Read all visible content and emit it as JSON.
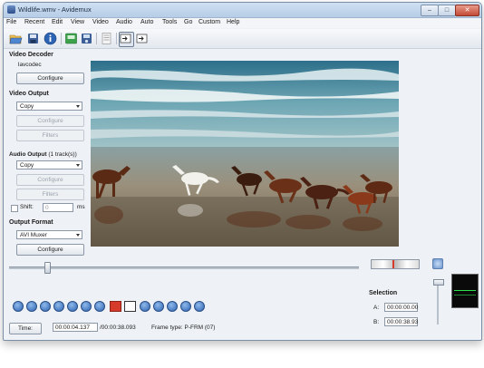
{
  "window": {
    "title": "Wildlife.wmv - Avidemux",
    "minimize": "–",
    "maximize": "□",
    "close": "✕"
  },
  "menu": [
    {
      "label": "File"
    },
    {
      "label": "Recent"
    },
    {
      "label": "Edit"
    },
    {
      "label": "View"
    },
    {
      "label": "Video"
    },
    {
      "label": "Audio"
    },
    {
      "label": "Auto"
    },
    {
      "label": "Tools"
    },
    {
      "label": "Go"
    },
    {
      "label": "Custom"
    },
    {
      "label": "Help"
    }
  ],
  "toolbar": {
    "icons": [
      "open-file-icon",
      "save-file-icon",
      "info-icon",
      "open-folder-icon",
      "save-project-icon",
      "script-icon",
      "input-preview-icon",
      "output-preview-icon"
    ]
  },
  "video_decoder": {
    "heading": "Video Decoder",
    "codec": "lavcodec",
    "configure": "Configure"
  },
  "video_output": {
    "heading": "Video Output",
    "selected": "Copy",
    "configure": "Configure",
    "filters": "Filters"
  },
  "audio_output": {
    "heading_bold": "Audio Output",
    "heading_suffix": " (1 track(s))",
    "selected": "Copy",
    "configure": "Configure",
    "filters": "Filters",
    "shift_label": "Shift:",
    "shift_value": "0",
    "shift_unit": "ms"
  },
  "output_format": {
    "heading": "Output Format",
    "selected": "AVI Muxer",
    "configure": "Configure"
  },
  "timeline": {
    "position": 0.109
  },
  "playback_buttons": [
    "play-icon",
    "stop-icon",
    "prev-frame-icon",
    "next-frame-icon",
    "prev-keyframe-icon",
    "next-keyframe-icon",
    "set-marker-a-icon",
    "set-marker-b-icon",
    "prev-black-frame-icon",
    "next-black-frame-icon",
    "goto-first-frame-icon",
    "goto-last-frame-icon",
    "goto-marker-a-icon",
    "goto-marker-b-icon"
  ],
  "status": {
    "time_button": "Time:",
    "current_time": "00:00:04.137",
    "total_time": "/00:00:38.093",
    "frame_type": "Frame type:  P-FRM (07)"
  },
  "selection": {
    "heading": "Selection",
    "a_label": "A:",
    "a_value": "00:00:00.00",
    "b_label": "B:",
    "b_value": "00:00:38.93"
  },
  "colors": {
    "accent": "#2d63b3",
    "marker_red": "#d63a2a"
  }
}
